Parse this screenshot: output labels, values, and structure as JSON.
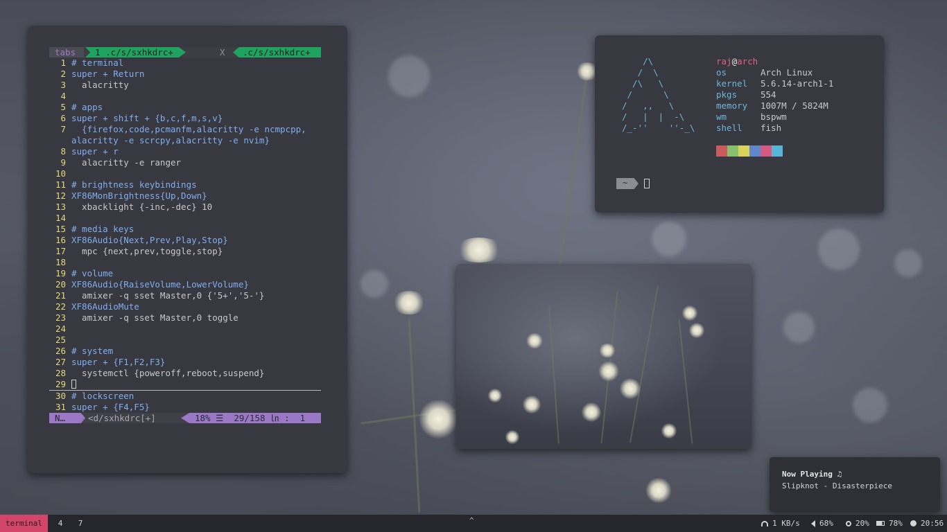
{
  "editor": {
    "tabline": {
      "label": "tabs",
      "active_tab": "1 .c/s/sxhkdrc+",
      "close": "X",
      "right_tab": ".c/s/sxhkdrc+"
    },
    "lines": [
      {
        "n": "1",
        "t": "# terminal",
        "cls": "c-com"
      },
      {
        "n": "2",
        "t": "super + Return",
        "cls": "c-kw"
      },
      {
        "n": "3",
        "t": "  alacritty",
        "cls": "c-txt"
      },
      {
        "n": "4",
        "t": "",
        "cls": "c-txt"
      },
      {
        "n": "5",
        "t": "# apps",
        "cls": "c-com"
      },
      {
        "n": "6",
        "t": "super + shift + {b,c,f,m,s,v}",
        "cls": "c-kw"
      },
      {
        "n": "7",
        "t": "  {firefox,code,pcmanfm,alacritty -e ncmpcpp,",
        "cls": "c-kw"
      },
      {
        "n": "",
        "t": "alacritty -e scrcpy,alacritty -e nvim}",
        "cls": "c-kw"
      },
      {
        "n": "8",
        "t": "super + r",
        "cls": "c-kw"
      },
      {
        "n": "9",
        "t": "  alacritty -e ranger",
        "cls": "c-txt"
      },
      {
        "n": "10",
        "t": "",
        "cls": "c-txt"
      },
      {
        "n": "11",
        "t": "# brightness keybindings",
        "cls": "c-com"
      },
      {
        "n": "12",
        "t": "XF86MonBrightness{Up,Down}",
        "cls": "c-kw"
      },
      {
        "n": "13",
        "t": "  xbacklight {-inc,-dec} 10",
        "cls": "c-txt"
      },
      {
        "n": "14",
        "t": "",
        "cls": "c-txt"
      },
      {
        "n": "15",
        "t": "# media keys",
        "cls": "c-com"
      },
      {
        "n": "16",
        "t": "XF86Audio{Next,Prev,Play,Stop}",
        "cls": "c-kw"
      },
      {
        "n": "17",
        "t": "  mpc {next,prev,toggle,stop}",
        "cls": "c-txt"
      },
      {
        "n": "18",
        "t": "",
        "cls": "c-txt"
      },
      {
        "n": "19",
        "t": "# volume",
        "cls": "c-com"
      },
      {
        "n": "20",
        "t": "XF86Audio{RaiseVolume,LowerVolume}",
        "cls": "c-kw"
      },
      {
        "n": "21",
        "t": "  amixer -q sset Master,0 {'5+','5-'}",
        "cls": "c-txt"
      },
      {
        "n": "22",
        "t": "XF86AudioMute",
        "cls": "c-kw"
      },
      {
        "n": "23",
        "t": "  amixer -q sset Master,0 toggle",
        "cls": "c-txt"
      },
      {
        "n": "24",
        "t": "",
        "cls": "c-txt"
      },
      {
        "n": "25",
        "t": "",
        "cls": "c-txt"
      },
      {
        "n": "26",
        "t": "# system",
        "cls": "c-com"
      },
      {
        "n": "27",
        "t": "super + {F1,F2,F3}",
        "cls": "c-kw"
      },
      {
        "n": "28",
        "t": "  systemctl {poweroff,reboot,suspend}",
        "cls": "c-txt"
      },
      {
        "n": "29",
        "t": "",
        "cls": "c-txt",
        "cursor": true
      },
      {
        "n": "30",
        "t": "# lockscreen",
        "cls": "c-com"
      },
      {
        "n": "31",
        "t": "super + {F4,F5}",
        "cls": "c-kw"
      }
    ],
    "statusline": {
      "mode": "N…",
      "file": "<d/sxhkdrc[+]",
      "right": "18% ☰  29/158 ㏑ :  1"
    }
  },
  "fetch": {
    "logo": "    /\\\n   /  \\\n  /\\   \\\n /      \\\n/   ,,   \\\n/   |  |  -\\\n/_-''    ''-_\\",
    "user": "raj",
    "at": "@",
    "host": "arch",
    "fields": [
      {
        "k": "os",
        "v": "Arch Linux"
      },
      {
        "k": "kernel",
        "v": "5.6.14-arch1-1"
      },
      {
        "k": "pkgs",
        "v": "554"
      },
      {
        "k": "memory",
        "v": "1007M / 5824M"
      },
      {
        "k": "wm",
        "v": "bspwm"
      },
      {
        "k": "shell",
        "v": "fish"
      }
    ],
    "palette": [
      "#c85b5b",
      "#88c070",
      "#d8d25a",
      "#5f87c9",
      "#d45a86",
      "#5ab4d6"
    ],
    "prompt": "~"
  },
  "notification": {
    "title": "Now Playing ♫",
    "body": "Slipknot - Disasterpiece"
  },
  "bar": {
    "active_workspace": "terminal",
    "workspaces": [
      "4",
      "7"
    ],
    "center": "^",
    "net": "1 KB/s",
    "volume": "68%",
    "brightness": "20%",
    "battery": "78%",
    "time": "20:56"
  }
}
